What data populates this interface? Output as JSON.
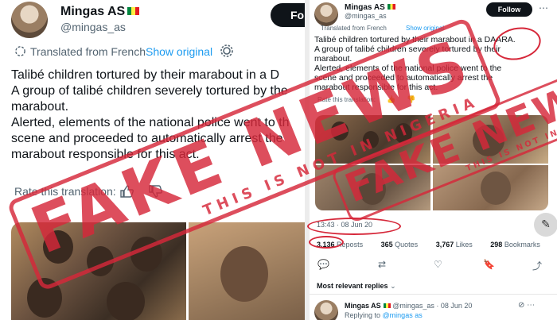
{
  "left": {
    "author_name": "Mingas AS",
    "handle": "@mingas_as",
    "follow_label": "Fol",
    "translated_from": "Translated from French",
    "show_original": "Show original",
    "tweet_lines": [
      "Talibé children tortured by their marabout in a D",
      "A group of talibé children severely tortured by the",
      "marabout.",
      "Alerted, elements of the national police went to th",
      "scene and proceeded to automatically arrest the",
      "marabout responsible for this act."
    ],
    "rate_label": "Rate this translation:"
  },
  "right": {
    "author_name": "Mingas AS",
    "handle": "@mingas_as",
    "follow_label": "Follow",
    "translated_from": "Translated from French",
    "show_original": "Show original",
    "tweet_lines": [
      "Talibé children tortured by their marabout in a DAARA.",
      "A group of talibé children severely tortured by their",
      "marabout.",
      "Alerted, elements of the national police went to the",
      "scene and proceeded to automatically arrest the",
      "marabout responsible for this act."
    ],
    "rate_label": "Rate this translation:",
    "timestamp": "13:43 · 08 Jun 20",
    "stats": {
      "reposts_count": "3,136",
      "reposts_label": "Reposts",
      "quotes_count": "365",
      "quotes_label": "Quotes",
      "likes_count": "3,767",
      "likes_label": "Likes",
      "bookmarks_count": "298",
      "bookmarks_label": "Bookmarks"
    },
    "most_relevant": "Most relevant replies",
    "reply": {
      "name": "Mingas AS",
      "handle_date": "@mingas_as · 08 Jun 20",
      "replying_prefix": "Replying to",
      "replying_to": "@mingas as"
    }
  },
  "stamp": {
    "main_text": "FAKE NEWS",
    "sub_text": "THIS IS NOT IN NIGERIA",
    "color": "#d6283a"
  },
  "colors": {
    "link": "#1d9bf0",
    "muted": "#536471",
    "text": "#0f1419",
    "follow_bg": "#0f1419"
  }
}
